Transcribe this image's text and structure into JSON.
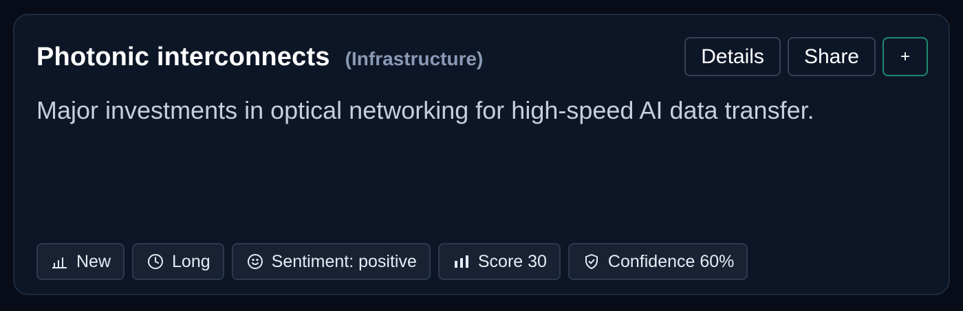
{
  "card": {
    "title": "Photonic interconnects",
    "category": "(Infrastructure)",
    "description": "Major investments in optical networking for high-speed AI data transfer."
  },
  "actions": {
    "details_label": "Details",
    "share_label": "Share",
    "add_label": "+"
  },
  "badges": [
    {
      "icon": "bar-chart-low-icon",
      "label": "New"
    },
    {
      "icon": "clock-icon",
      "label": "Long"
    },
    {
      "icon": "smile-icon",
      "label": "Sentiment: positive"
    },
    {
      "icon": "bar-chart-icon",
      "label": "Score 30"
    },
    {
      "icon": "shield-check-icon",
      "label": "Confidence 60%"
    }
  ],
  "colors": {
    "background": "#070c18",
    "card": "#0d1626",
    "accent_border": "#1f8a73",
    "muted_text": "#8a9ab5"
  }
}
